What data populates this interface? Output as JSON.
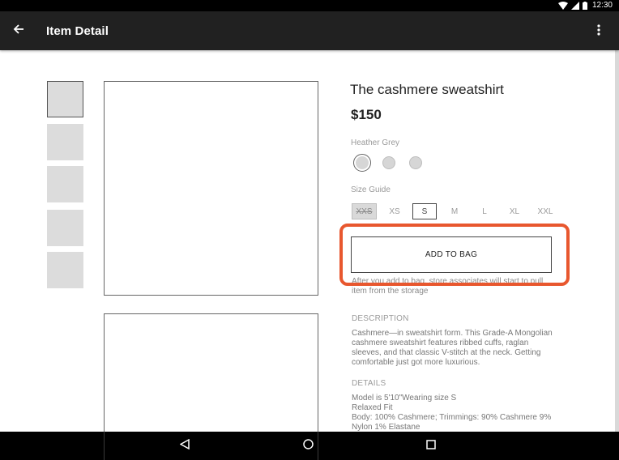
{
  "status_bar": {
    "time": "12:30",
    "icons": [
      "wifi-icon",
      "signal-icon",
      "battery-icon"
    ]
  },
  "app_bar": {
    "title": "Item Detail",
    "back_icon": "arrow-left-icon",
    "menu_icon": "more-vert-icon"
  },
  "product": {
    "title": "The cashmere sweatshirt",
    "price": "$150",
    "color_label": "Heather Grey",
    "size_label": "Size Guide",
    "sizes": [
      "XXS",
      "XS",
      "S",
      "M",
      "L",
      "XL",
      "XXL"
    ],
    "selected_size": "S",
    "unavailable_size": "XXS",
    "add_button": "ADD TO BAG",
    "note": "After you add to bag, store associates will start to pull item from the storage",
    "description_label": "DESCRIPTION",
    "description": "Cashmere—in sweatshirt form. This Grade-A Mongolian cashmere sweatshirt features ribbed cuffs, raglan sleeves, and that classic V-stitch at the neck. Getting comfortable just got more luxurious.",
    "details_label": "DETAILS",
    "details": [
      "Model is 5'10\"Wearing size S",
      "Relaxed Fit",
      "Body: 100% Cashmere; Trimmings: 90% Cashmere 9% Nylon 1% Elastane"
    ]
  },
  "colors": {
    "highlight": "#e8572e",
    "app_bar": "#212121",
    "placeholder": "#dcdcdc"
  },
  "nav_bar": {
    "icons": [
      "back-triangle-icon",
      "home-circle-icon",
      "recents-square-icon"
    ]
  }
}
